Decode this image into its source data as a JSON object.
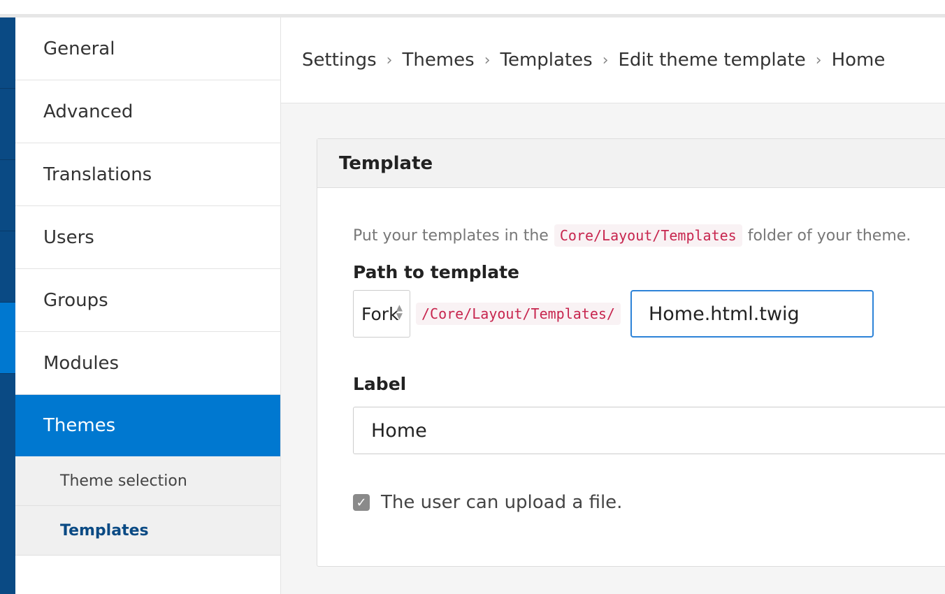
{
  "sidebar": {
    "items": [
      {
        "label": "General"
      },
      {
        "label": "Advanced"
      },
      {
        "label": "Translations"
      },
      {
        "label": "Users"
      },
      {
        "label": "Groups"
      },
      {
        "label": "Modules"
      },
      {
        "label": "Themes"
      }
    ],
    "sub_items": [
      {
        "label": "Theme selection"
      },
      {
        "label": "Templates"
      }
    ]
  },
  "breadcrumb": [
    "Settings",
    "Themes",
    "Templates",
    "Edit theme template",
    "Home"
  ],
  "breadcrumb_separator": "›",
  "panel": {
    "title": "Template",
    "help_prefix": "Put your templates in the",
    "help_code": "Core/Layout/Templates",
    "help_suffix": "folder of your theme.",
    "path_label": "Path to template",
    "theme_select_value": "Fork",
    "path_prefix": "/Core/Layout/Templates/",
    "file_value": "Home.html.twig",
    "label_label": "Label",
    "label_value": "Home",
    "upload_checkbox_label": "The user can upload a file.",
    "upload_checked": true
  },
  "colors": {
    "accent": "#0078d0",
    "rail": "#0a4a84",
    "code_text": "#c7254e",
    "focus_border": "#2d83d8"
  }
}
